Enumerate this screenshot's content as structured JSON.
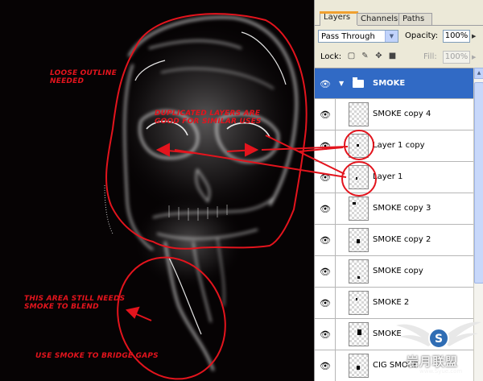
{
  "annotations": {
    "outline": "LOOSE OUTLINE\nNEEDED",
    "duplicated": "DUPLICATED LAYERS ARE\nGOOD FOR SIMILAR USES",
    "area_blend": "THIS AREA STILL NEEDS\nSMOKE TO BLEND",
    "bridge": "USE SMOKE TO BRIDGE GAPS"
  },
  "panel": {
    "tabs": [
      {
        "label": "Layers",
        "active": true
      },
      {
        "label": "Channels",
        "active": false
      },
      {
        "label": "Paths",
        "active": false
      }
    ],
    "blend_mode": "Pass Through",
    "opacity_label": "Opacity:",
    "opacity_value": "100%",
    "lock_label": "Lock:",
    "fill_label": "Fill:",
    "fill_value": "100%",
    "layers": [
      {
        "name": "SMOKE",
        "type": "group",
        "selected": true
      },
      {
        "name": "SMOKE copy 4",
        "type": "layer"
      },
      {
        "name": "Layer 1 copy",
        "type": "layer"
      },
      {
        "name": "Layer 1",
        "type": "layer"
      },
      {
        "name": "SMOKE copy 3",
        "type": "layer"
      },
      {
        "name": "SMOKE copy 2",
        "type": "layer"
      },
      {
        "name": "SMOKE copy",
        "type": "layer"
      },
      {
        "name": "SMOKE 2",
        "type": "layer"
      },
      {
        "name": "SMOKE",
        "type": "layer"
      },
      {
        "name": "CIG SMOKE",
        "type": "layer"
      }
    ]
  },
  "watermark": {
    "logo_text": "S",
    "text": "岩月联盟",
    "sub": "www.Syue.com"
  },
  "colors": {
    "annotation_red": "#e3141d",
    "selection_blue": "#316ac5",
    "panel_bg": "#ece9d8"
  }
}
